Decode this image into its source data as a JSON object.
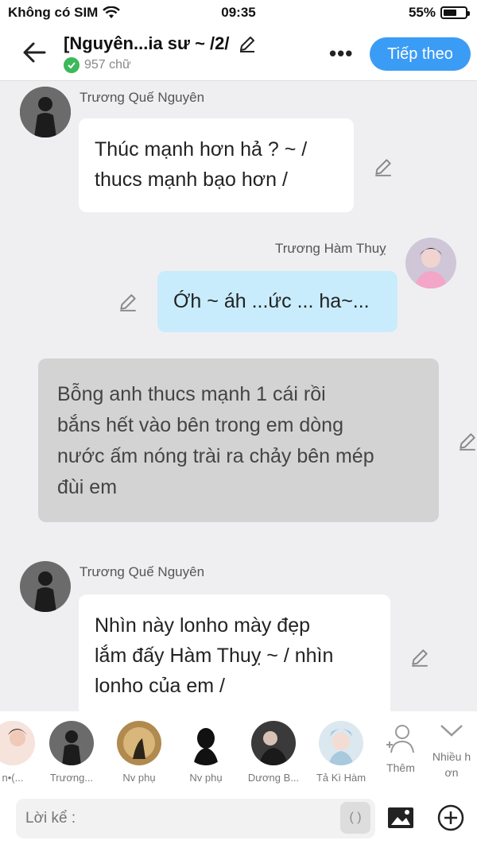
{
  "status": {
    "carrier": "Không có SIM",
    "time": "09:35",
    "battery": "55%"
  },
  "header": {
    "title": "[Nguyên...ia sư ~ /2/",
    "word_count": "957 chữ",
    "next_label": "Tiếp theo"
  },
  "messages": [
    {
      "speaker": "Trương Quế Nguyên",
      "lines": [
        "Thúc mạnh hơn hả ? ~ /",
        "thucs mạnh bạo hơn /"
      ]
    },
    {
      "speaker": "Trương Hàm Thuỵ",
      "lines": [
        "Ớh ~ áh ...ức ... ha~..."
      ]
    },
    {
      "lines": [
        "Bỗng anh thucs mạnh 1 cái rồi",
        "bắns hết vào bên trong em dòng",
        "nước ấm nóng trài ra chảy bên mép",
        "đùi em"
      ]
    },
    {
      "speaker": "Trương Quế Nguyên",
      "lines": [
        "Nhìn này lonho mày đẹp",
        "lắm đấy Hàm Thuỵ ~ / nhìn",
        "lonho của em /"
      ]
    }
  ],
  "characters": [
    "n•(...",
    "Trương...",
    "Nv phụ",
    "Nv phụ",
    "Dương B...",
    "Tả Kì Hàm",
    "Thêm",
    "Nhiều h ơn"
  ],
  "input": {
    "placeholder": "Lời kể :",
    "paren": "( )"
  }
}
